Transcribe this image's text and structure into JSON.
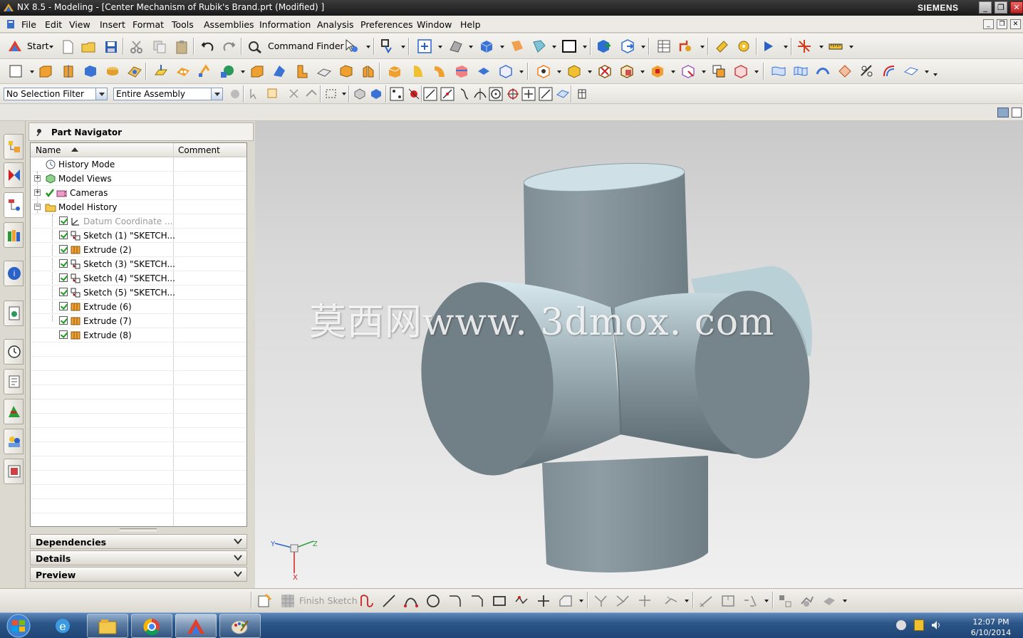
{
  "window": {
    "title": "NX 8.5 - Modeling - [Center Mechanism of Rubik's Brand.prt (Modified) ]",
    "brand": "SIEMENS"
  },
  "menu": {
    "items": [
      "File",
      "Edit",
      "View",
      "Insert",
      "Format",
      "Tools",
      "Assemblies",
      "Information",
      "Analysis",
      "Preferences",
      "Window",
      "Help"
    ]
  },
  "toolbar": {
    "start_label": "Start",
    "command_finder_label": "Command Finder"
  },
  "filters": {
    "selection_filter": "No Selection Filter",
    "scope": "Entire Assembly"
  },
  "navigator": {
    "title": "Part Navigator",
    "columns": {
      "name": "Name",
      "comment": "Comment"
    },
    "rows": [
      {
        "label": "History Mode",
        "icon": "history-icon"
      },
      {
        "label": "Model Views",
        "icon": "model-views-icon"
      },
      {
        "label": "Cameras",
        "icon": "camera-icon"
      },
      {
        "label": "Model History",
        "icon": "folder-icon"
      },
      {
        "label": "Datum Coordinate ...",
        "icon": "datum-csys-icon"
      },
      {
        "label": "Sketch (1) \"SKETCH...",
        "icon": "sketch-icon"
      },
      {
        "label": "Extrude (2)",
        "icon": "extrude-icon"
      },
      {
        "label": "Sketch (3) \"SKETCH...",
        "icon": "sketch-icon"
      },
      {
        "label": "Sketch (4) \"SKETCH...",
        "icon": "sketch-icon"
      },
      {
        "label": "Sketch (5) \"SKETCH...",
        "icon": "sketch-icon"
      },
      {
        "label": "Extrude (6)",
        "icon": "extrude-icon"
      },
      {
        "label": "Extrude (7)",
        "icon": "extrude-icon"
      },
      {
        "label": "Extrude (8)",
        "icon": "extrude-icon"
      }
    ],
    "panels": [
      "Dependencies",
      "Details",
      "Preview"
    ]
  },
  "viewport": {
    "watermark": "莫西网www. 3dmox. com",
    "axes": {
      "x": "X",
      "y": "Y",
      "z": "Z"
    }
  },
  "sketch_toolbar": {
    "finish_label": "Finish Sketch"
  },
  "taskbar": {
    "time": "12:07 PM",
    "date": "6/10/2014"
  },
  "colors": {
    "model_light": "#c8dde3",
    "model_dark": "#6b7a82",
    "accent": "#2d5789"
  }
}
